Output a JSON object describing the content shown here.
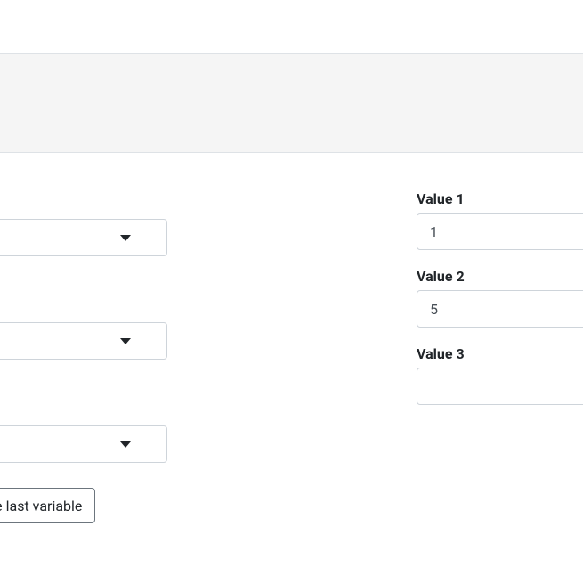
{
  "left": {
    "selects": [
      {
        "value": ""
      },
      {
        "value": ""
      },
      {
        "value": ""
      }
    ],
    "remove_button": "emove last variable"
  },
  "right": {
    "fields": [
      {
        "label": "Value 1",
        "value": "1"
      },
      {
        "label": "Value 2",
        "value": "5"
      },
      {
        "label": "Value 3",
        "value": ""
      }
    ]
  }
}
